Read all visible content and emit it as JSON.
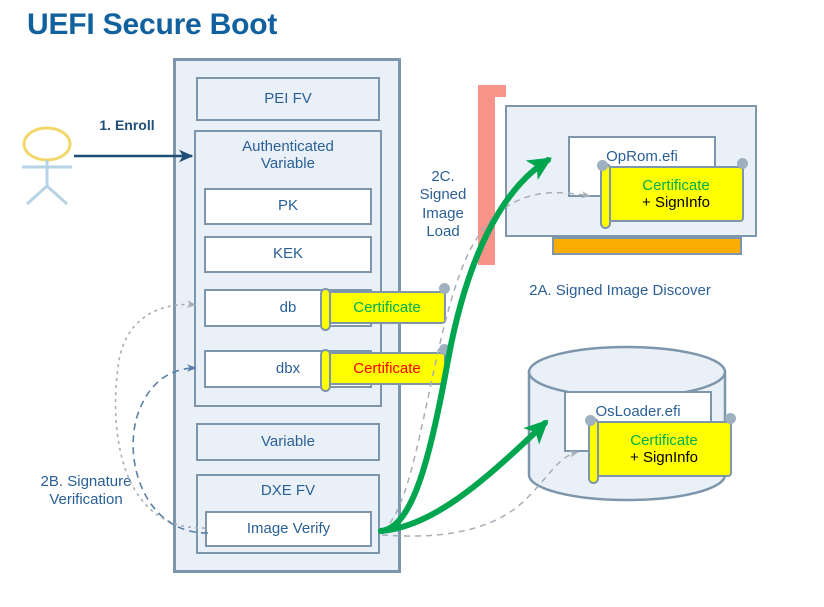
{
  "title": "UEFI Secure Boot",
  "actor": {
    "name": "user-actor",
    "head_color": "#f2d76b",
    "body_color": "#b7d3e6"
  },
  "flows": {
    "enroll": "1. Enroll",
    "signed_image_load": "2C. Signed Image Load",
    "signed_image_discover": "2A. Signed Image Discover",
    "signature_verification": "2B. Signature Verification"
  },
  "firmware": {
    "pei_fv": "PEI FV",
    "authenticated_variable": "Authenticated Variable",
    "pk": "PK",
    "kek": "KEK",
    "db": "db",
    "dbx": "dbx",
    "variable": "Variable",
    "dxe_fv": "DXE FV",
    "image_verify": "Image Verify"
  },
  "certificates": {
    "db_cert": {
      "label": "Certificate",
      "color": "#00b050"
    },
    "dbx_cert": {
      "label": "Certificate",
      "color": "#ff0000"
    },
    "oprom_cert": {
      "line1": "Certificate",
      "line2": "+ SignInfo",
      "color": "#00b050"
    },
    "osloader_cert": {
      "line1": "Certificate",
      "line2": "+ SignInfo",
      "color": "#00b050"
    }
  },
  "images": {
    "oprom": "OpRom.efi",
    "osloader": "OsLoader.efi"
  },
  "colors": {
    "title": "#11619e",
    "text_blue": "#2b6096",
    "box_fill": "#eaf0f8",
    "box_border": "#7d96ac",
    "green_arrow": "#00a550",
    "pink_bar": "#f8938a",
    "orange_strip": "#fbad06",
    "cert_yellow": "#ffff00",
    "enroll_arrow": "#1f4e79"
  }
}
